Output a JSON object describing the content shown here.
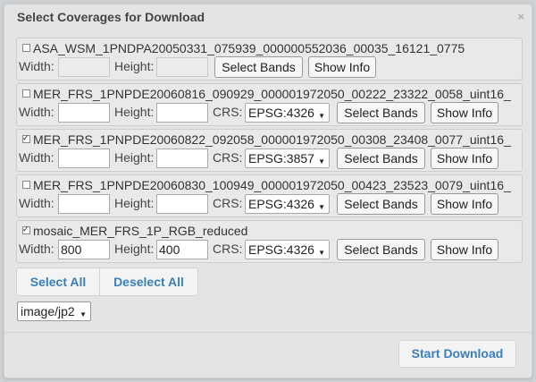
{
  "dialog": {
    "title": "Select Coverages for Download",
    "close_label": "×"
  },
  "labels": {
    "width": "Width:",
    "height": "Height:",
    "crs": "CRS:",
    "select_bands": "Select Bands",
    "show_info": "Show Info"
  },
  "coverages": [
    {
      "name": "ASA_WSM_1PNDPA20050331_075939_000000552036_00035_16121_0775",
      "checked": false,
      "width": "",
      "height": "",
      "crs": null
    },
    {
      "name": "MER_FRS_1PNPDE20060816_090929_000001972050_00222_23322_0058_uint16_",
      "checked": false,
      "width": "",
      "height": "",
      "crs": "EPSG:4326"
    },
    {
      "name": "MER_FRS_1PNPDE20060822_092058_000001972050_00308_23408_0077_uint16_",
      "checked": true,
      "width": "",
      "height": "",
      "crs": "EPSG:3857"
    },
    {
      "name": "MER_FRS_1PNPDE20060830_100949_000001972050_00423_23523_0079_uint16_",
      "checked": false,
      "width": "",
      "height": "",
      "crs": "EPSG:4326"
    },
    {
      "name": "mosaic_MER_FRS_1P_RGB_reduced",
      "checked": true,
      "width": "800",
      "height": "400",
      "crs": "EPSG:4326"
    }
  ],
  "actions": {
    "select_all": "Select All",
    "deselect_all": "Deselect All",
    "format": "image/jp2",
    "start_download": "Start Download"
  },
  "colors": {
    "link_blue": "#3a7fbd",
    "dialog_bg": "#e4e4e4"
  }
}
